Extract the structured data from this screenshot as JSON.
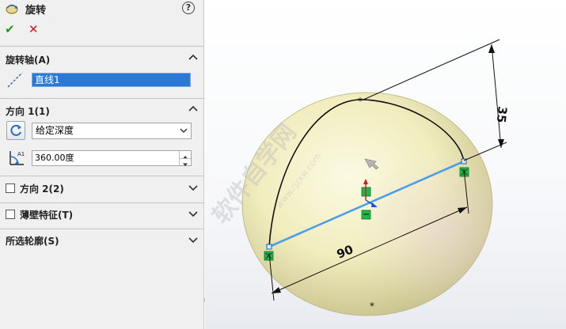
{
  "feature": {
    "title": "旋转",
    "help": "?"
  },
  "actions": {
    "ok": "✔",
    "cancel": "✕"
  },
  "axis_section": {
    "title": "旋转轴(A)",
    "selected": "直线1"
  },
  "direction1": {
    "title": "方向 1(1)",
    "end_condition": "给定深度",
    "angle_value": "360.00度"
  },
  "direction2": {
    "label": "方向 2(2)"
  },
  "thin_feature": {
    "label": "薄壁特征(T)"
  },
  "selected_contours": {
    "title": "所选轮廓(S)"
  },
  "viewport": {
    "dim_vertical": "35",
    "dim_horizontal": "90",
    "watermark_main": "软件自学网",
    "watermark_url": "www.rjzxw.com"
  },
  "colors": {
    "accent": "#2a79d6",
    "ok": "#1a9a1a",
    "cancel": "#d11a1a",
    "sketch_line": "#4a9fe8",
    "body_fill": "#f3f0c4"
  },
  "icons": {
    "feature": "revolve-icon",
    "axis": "centerline-icon",
    "direction": "reverse-direction-icon",
    "angle": "angle-icon"
  }
}
